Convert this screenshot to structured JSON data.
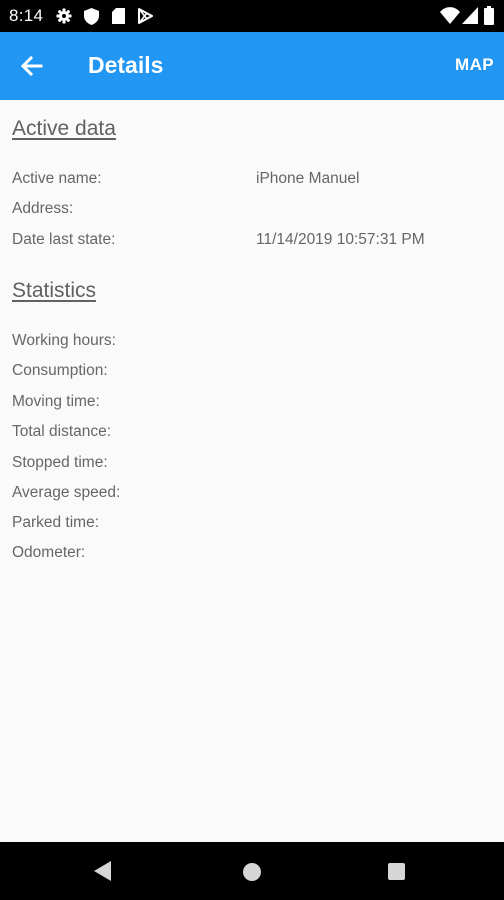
{
  "status_bar": {
    "time": "8:14",
    "icons": [
      "gear-icon",
      "shield-icon",
      "sd-card-icon",
      "play-store-icon",
      "wifi-icon",
      "signal-icon",
      "battery-icon"
    ]
  },
  "app_bar": {
    "title": "Details",
    "map_label": "MAP",
    "color": "#2196f3"
  },
  "active_data": {
    "title": "Active data",
    "rows": [
      {
        "label": "Active name:",
        "value": "iPhone Manuel"
      },
      {
        "label": "Address:",
        "value": ""
      },
      {
        "label": "Date last state:",
        "value": "11/14/2019 10:57:31 PM"
      }
    ]
  },
  "statistics": {
    "title": "Statistics",
    "rows": [
      {
        "label": "Working hours:",
        "value": ""
      },
      {
        "label": "Consumption:",
        "value": ""
      },
      {
        "label": "Moving time:",
        "value": ""
      },
      {
        "label": "Total distance:",
        "value": ""
      },
      {
        "label": "Stopped time:",
        "value": ""
      },
      {
        "label": "Average speed:",
        "value": ""
      },
      {
        "label": "Parked time:",
        "value": ""
      },
      {
        "label": "Odometer:",
        "value": ""
      }
    ]
  },
  "nav_bar": {
    "icons": [
      "back-triangle-icon",
      "home-circle-icon",
      "recents-square-icon"
    ]
  }
}
